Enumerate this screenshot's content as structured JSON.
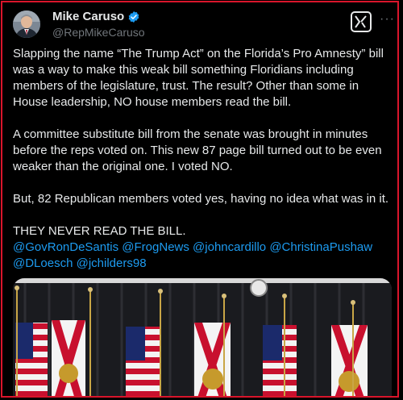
{
  "author": {
    "name": "Mike Caruso",
    "handle": "@RepMikeCaruso"
  },
  "header_icons": {
    "verified": "verified-badge-icon",
    "grok": "grok-icon",
    "more": "more-options-icon",
    "more_glyph": "···"
  },
  "tweet": {
    "paragraphs": [
      "Slapping the name “The Trump Act” on the Florida’s Pro Amnesty” bill was a way to make this weak bill something Floridians including members of the legislature, trust. The result? Other than some in House leadership, NO house members read the bill.",
      "A committee substitute bill from the senate was brought in minutes before the reps voted on. This new 87 page bill turned out to be even weaker than the original one. I voted NO.",
      "But, 82 Republican members voted yes, having no idea what was in it.",
      "THEY NEVER READ THE BILL."
    ],
    "mentions": [
      "@GovRonDeSantis",
      "@FrogNews",
      "@johncardillo",
      "@ChristinaPushaw",
      "@DLoesch",
      "@jchilders98"
    ]
  },
  "colors": {
    "background": "#000000",
    "text": "#e7e9ea",
    "secondary": "#71767b",
    "link": "#1d9bf0",
    "frame": "#d9152b"
  }
}
